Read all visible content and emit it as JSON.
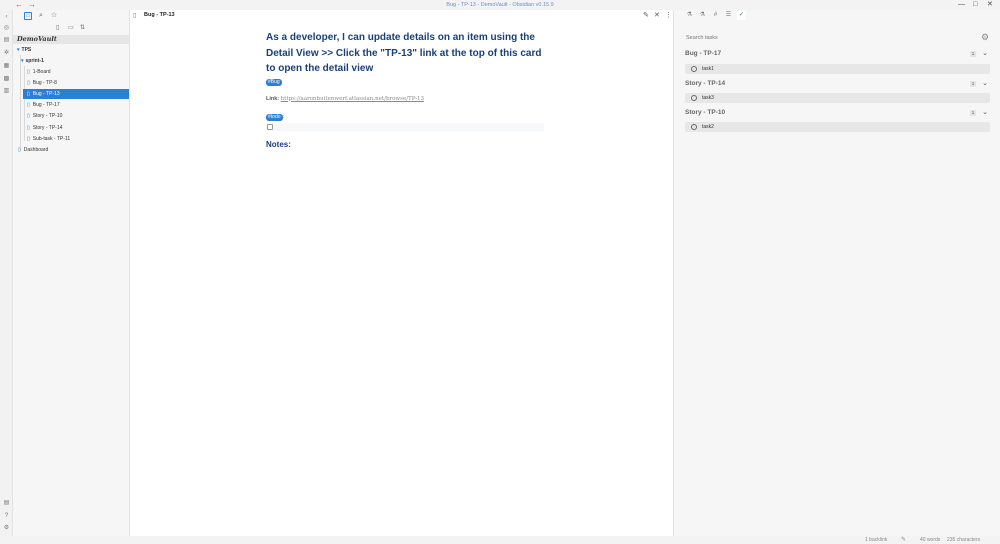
{
  "window": {
    "title": "Bug - TP-13 - DemoVault - Obsidian v0.15.9",
    "back_arrow": "←",
    "forward_arrow": "→",
    "minimize": "—",
    "maximize": "□",
    "close": "✕"
  },
  "sidebar": {
    "vault_name": "DemoVault",
    "tree": [
      {
        "label": "TPS",
        "kind": "folder"
      },
      {
        "label": "sprint-1",
        "kind": "folder"
      },
      {
        "label": "1-Board",
        "kind": "file"
      },
      {
        "label": "Bug - TP-8",
        "kind": "file"
      },
      {
        "label": "Bug - TP-13",
        "kind": "file",
        "selected": true
      },
      {
        "label": "Bug - TP-17",
        "kind": "file"
      },
      {
        "label": "Story - TP-10",
        "kind": "file"
      },
      {
        "label": "Story - TP-14",
        "kind": "file"
      },
      {
        "label": "Sub-task - TP-11",
        "kind": "file"
      },
      {
        "label": "Dashboard",
        "kind": "file"
      }
    ]
  },
  "editor": {
    "tab_title": "Bug - TP-13",
    "heading_lines": [
      "As a developer, I can update details on an item using the",
      "Detail View >> Click the \"TP-13\" link at the top of this card",
      "to open the detail view"
    ],
    "tag_bug": "#Bug",
    "link_label": "Link:",
    "link_url": "https://aaronbuitenwerf.atlassian.net/browse/TP-13",
    "tag_todo": "#todo",
    "tag_todo_suffix": ":",
    "notes_heading": "Notes:"
  },
  "right_panel": {
    "search_placeholder": "Search tasks",
    "groups": [
      {
        "title": "Bug - TP-17",
        "count": "1",
        "tasks": [
          "task1"
        ]
      },
      {
        "title": "Story - TP-14",
        "count": "1",
        "tasks": [
          "task3"
        ]
      },
      {
        "title": "Story - TP-10",
        "count": "1",
        "tasks": [
          "task2"
        ]
      }
    ]
  },
  "statusbar": {
    "backlinks": "1 backlink",
    "words": "40 words",
    "characters": "235 characters"
  },
  "colors": {
    "accent": "#2b7fd6",
    "heading": "#1a3f7a",
    "arrow": "#c9474b"
  }
}
